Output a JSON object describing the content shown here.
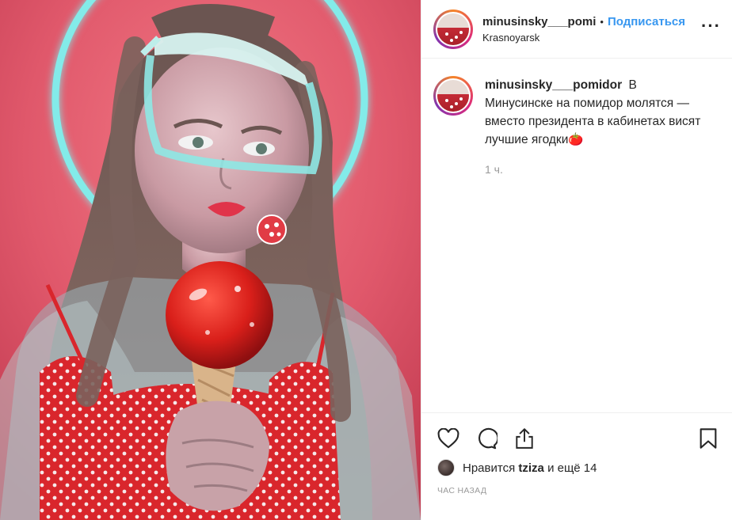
{
  "post": {
    "author": "minusinsky___pomi",
    "follow_label": "Подписаться",
    "separator": "•",
    "location": "Krasnoyarsk",
    "more_label": "···"
  },
  "caption": {
    "username": "minusinsky___pomidor",
    "text": "В Минусинске на помидор молятся — вместо президента в кабинетах висят лучшие ягодки🍅",
    "time": "1 ч."
  },
  "actions": {
    "like_icon": "heart-icon",
    "comment_icon": "comment-icon",
    "share_icon": "share-icon",
    "save_icon": "bookmark-icon"
  },
  "likes": {
    "prefix": "Нравится",
    "user": "tziza",
    "suffix": "и ещё 14"
  },
  "timestamp": "час назад",
  "colors": {
    "link": "#3897f0",
    "photo_bg": "#e3566a",
    "halo": "#7ef3f0"
  }
}
